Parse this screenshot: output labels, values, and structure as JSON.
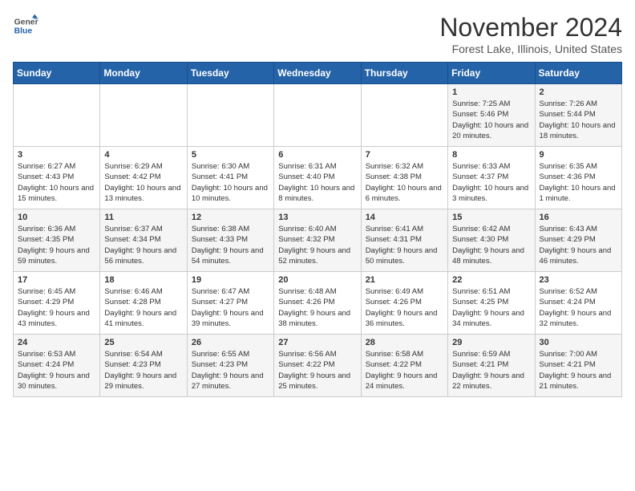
{
  "header": {
    "logo_line1": "General",
    "logo_line2": "Blue",
    "month_year": "November 2024",
    "location": "Forest Lake, Illinois, United States"
  },
  "days_of_week": [
    "Sunday",
    "Monday",
    "Tuesday",
    "Wednesday",
    "Thursday",
    "Friday",
    "Saturday"
  ],
  "weeks": [
    [
      {
        "day": "",
        "info": ""
      },
      {
        "day": "",
        "info": ""
      },
      {
        "day": "",
        "info": ""
      },
      {
        "day": "",
        "info": ""
      },
      {
        "day": "",
        "info": ""
      },
      {
        "day": "1",
        "info": "Sunrise: 7:25 AM\nSunset: 5:46 PM\nDaylight: 10 hours and 20 minutes."
      },
      {
        "day": "2",
        "info": "Sunrise: 7:26 AM\nSunset: 5:44 PM\nDaylight: 10 hours and 18 minutes."
      }
    ],
    [
      {
        "day": "3",
        "info": "Sunrise: 6:27 AM\nSunset: 4:43 PM\nDaylight: 10 hours and 15 minutes."
      },
      {
        "day": "4",
        "info": "Sunrise: 6:29 AM\nSunset: 4:42 PM\nDaylight: 10 hours and 13 minutes."
      },
      {
        "day": "5",
        "info": "Sunrise: 6:30 AM\nSunset: 4:41 PM\nDaylight: 10 hours and 10 minutes."
      },
      {
        "day": "6",
        "info": "Sunrise: 6:31 AM\nSunset: 4:40 PM\nDaylight: 10 hours and 8 minutes."
      },
      {
        "day": "7",
        "info": "Sunrise: 6:32 AM\nSunset: 4:38 PM\nDaylight: 10 hours and 6 minutes."
      },
      {
        "day": "8",
        "info": "Sunrise: 6:33 AM\nSunset: 4:37 PM\nDaylight: 10 hours and 3 minutes."
      },
      {
        "day": "9",
        "info": "Sunrise: 6:35 AM\nSunset: 4:36 PM\nDaylight: 10 hours and 1 minute."
      }
    ],
    [
      {
        "day": "10",
        "info": "Sunrise: 6:36 AM\nSunset: 4:35 PM\nDaylight: 9 hours and 59 minutes."
      },
      {
        "day": "11",
        "info": "Sunrise: 6:37 AM\nSunset: 4:34 PM\nDaylight: 9 hours and 56 minutes."
      },
      {
        "day": "12",
        "info": "Sunrise: 6:38 AM\nSunset: 4:33 PM\nDaylight: 9 hours and 54 minutes."
      },
      {
        "day": "13",
        "info": "Sunrise: 6:40 AM\nSunset: 4:32 PM\nDaylight: 9 hours and 52 minutes."
      },
      {
        "day": "14",
        "info": "Sunrise: 6:41 AM\nSunset: 4:31 PM\nDaylight: 9 hours and 50 minutes."
      },
      {
        "day": "15",
        "info": "Sunrise: 6:42 AM\nSunset: 4:30 PM\nDaylight: 9 hours and 48 minutes."
      },
      {
        "day": "16",
        "info": "Sunrise: 6:43 AM\nSunset: 4:29 PM\nDaylight: 9 hours and 46 minutes."
      }
    ],
    [
      {
        "day": "17",
        "info": "Sunrise: 6:45 AM\nSunset: 4:29 PM\nDaylight: 9 hours and 43 minutes."
      },
      {
        "day": "18",
        "info": "Sunrise: 6:46 AM\nSunset: 4:28 PM\nDaylight: 9 hours and 41 minutes."
      },
      {
        "day": "19",
        "info": "Sunrise: 6:47 AM\nSunset: 4:27 PM\nDaylight: 9 hours and 39 minutes."
      },
      {
        "day": "20",
        "info": "Sunrise: 6:48 AM\nSunset: 4:26 PM\nDaylight: 9 hours and 38 minutes."
      },
      {
        "day": "21",
        "info": "Sunrise: 6:49 AM\nSunset: 4:26 PM\nDaylight: 9 hours and 36 minutes."
      },
      {
        "day": "22",
        "info": "Sunrise: 6:51 AM\nSunset: 4:25 PM\nDaylight: 9 hours and 34 minutes."
      },
      {
        "day": "23",
        "info": "Sunrise: 6:52 AM\nSunset: 4:24 PM\nDaylight: 9 hours and 32 minutes."
      }
    ],
    [
      {
        "day": "24",
        "info": "Sunrise: 6:53 AM\nSunset: 4:24 PM\nDaylight: 9 hours and 30 minutes."
      },
      {
        "day": "25",
        "info": "Sunrise: 6:54 AM\nSunset: 4:23 PM\nDaylight: 9 hours and 29 minutes."
      },
      {
        "day": "26",
        "info": "Sunrise: 6:55 AM\nSunset: 4:23 PM\nDaylight: 9 hours and 27 minutes."
      },
      {
        "day": "27",
        "info": "Sunrise: 6:56 AM\nSunset: 4:22 PM\nDaylight: 9 hours and 25 minutes."
      },
      {
        "day": "28",
        "info": "Sunrise: 6:58 AM\nSunset: 4:22 PM\nDaylight: 9 hours and 24 minutes."
      },
      {
        "day": "29",
        "info": "Sunrise: 6:59 AM\nSunset: 4:21 PM\nDaylight: 9 hours and 22 minutes."
      },
      {
        "day": "30",
        "info": "Sunrise: 7:00 AM\nSunset: 4:21 PM\nDaylight: 9 hours and 21 minutes."
      }
    ]
  ]
}
